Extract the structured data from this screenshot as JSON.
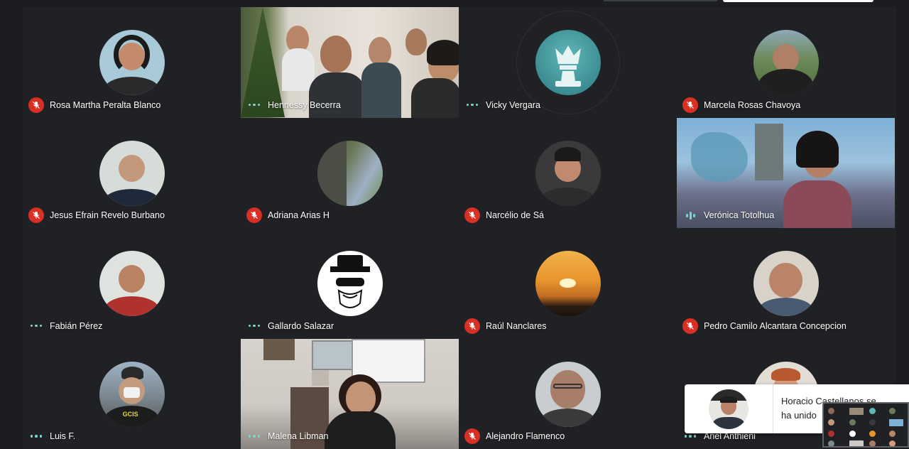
{
  "participants": [
    {
      "name": "Rosa Martha Peralta Blanco",
      "status": "muted"
    },
    {
      "name": "Hennessy Becerra",
      "status": "dots"
    },
    {
      "name": "Vicky Vergara",
      "status": "dots"
    },
    {
      "name": "Marcela Rosas Chavoya",
      "status": "muted"
    },
    {
      "name": "Jesus Efrain Revelo Burbano",
      "status": "muted"
    },
    {
      "name": "Adriana Arias H",
      "status": "muted"
    },
    {
      "name": "Narcélio de Sá",
      "status": "muted"
    },
    {
      "name": "Verónica Totolhua",
      "status": "speaking"
    },
    {
      "name": "Fabián Pérez",
      "status": "dots"
    },
    {
      "name": "Gallardo Salazar",
      "status": "dots"
    },
    {
      "name": "Raúl Nanclares",
      "status": "muted"
    },
    {
      "name": "Pedro Camilo Alcantara Concepcion",
      "status": "muted"
    },
    {
      "name": "Luis F.",
      "status": "dots"
    },
    {
      "name": "Malena Libman",
      "status": "dots"
    },
    {
      "name": "Alejandro Flamenco",
      "status": "muted"
    },
    {
      "name": "Ariel Anthieni",
      "status": "dots"
    }
  ],
  "toast": {
    "message": "Horacio Castellanos se ha unido"
  },
  "colors": {
    "background": "#202124",
    "muted_badge": "#d93025",
    "activity_dots": "#7cd7c9"
  }
}
